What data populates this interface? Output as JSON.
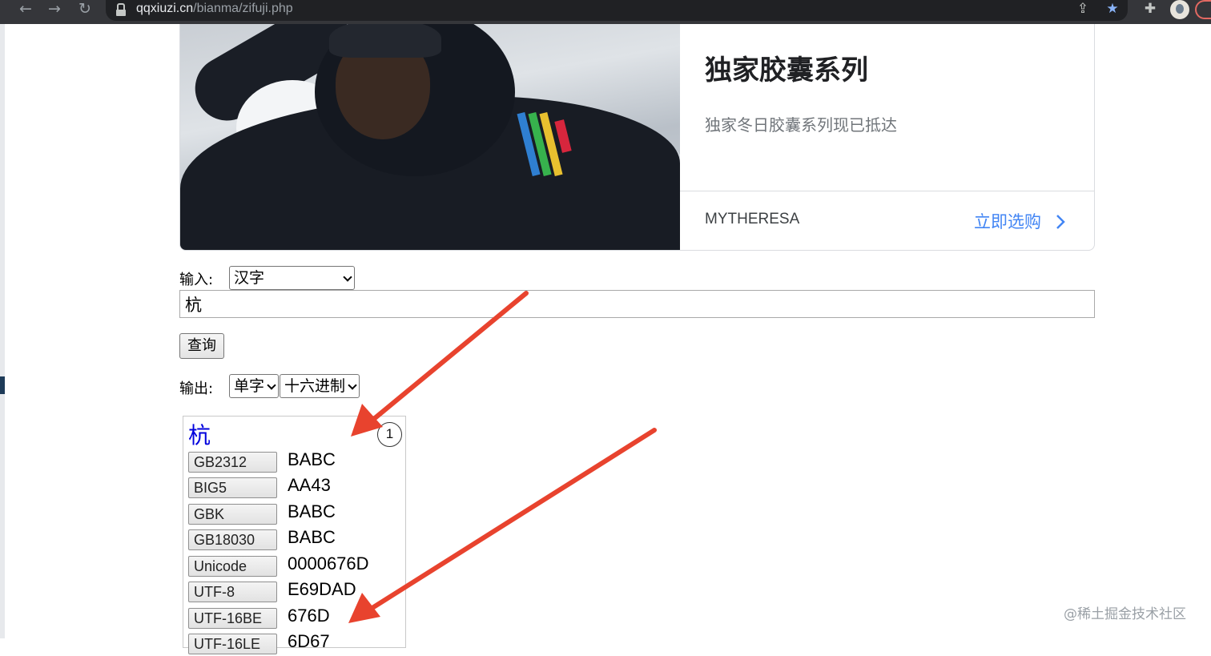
{
  "browser": {
    "url_host": "qqxiuzi.cn",
    "url_path": "/bianma/zifuji.php"
  },
  "ad": {
    "title": "独家胶囊系列",
    "subtitle": "独家冬日胶囊系列现已抵达",
    "brand": "MYTHERESA",
    "cta": "立即选购"
  },
  "form": {
    "input_label": "输入:",
    "input_type": "汉字",
    "text_value": "杭",
    "query_button": "查询",
    "output_label": "输出:",
    "output_mode": "单字",
    "output_format": "十六进制"
  },
  "result": {
    "char": "杭",
    "badge": "1",
    "rows": [
      {
        "encoding": "GB2312",
        "value": "BABC"
      },
      {
        "encoding": "BIG5",
        "value": "AA43"
      },
      {
        "encoding": "GBK",
        "value": "BABC"
      },
      {
        "encoding": "GB18030",
        "value": "BABC"
      },
      {
        "encoding": "Unicode",
        "value": "0000676D"
      },
      {
        "encoding": "UTF-8",
        "value": "E69DAD"
      },
      {
        "encoding": "UTF-16BE",
        "value": "676D"
      },
      {
        "encoding": "UTF-16LE",
        "value": "6D67"
      }
    ]
  },
  "colors": {
    "annotation_arrow": "#e8432e",
    "result_char": "#0000dd",
    "cta": "#4285f4"
  },
  "watermark": "@稀土掘金技术社区"
}
